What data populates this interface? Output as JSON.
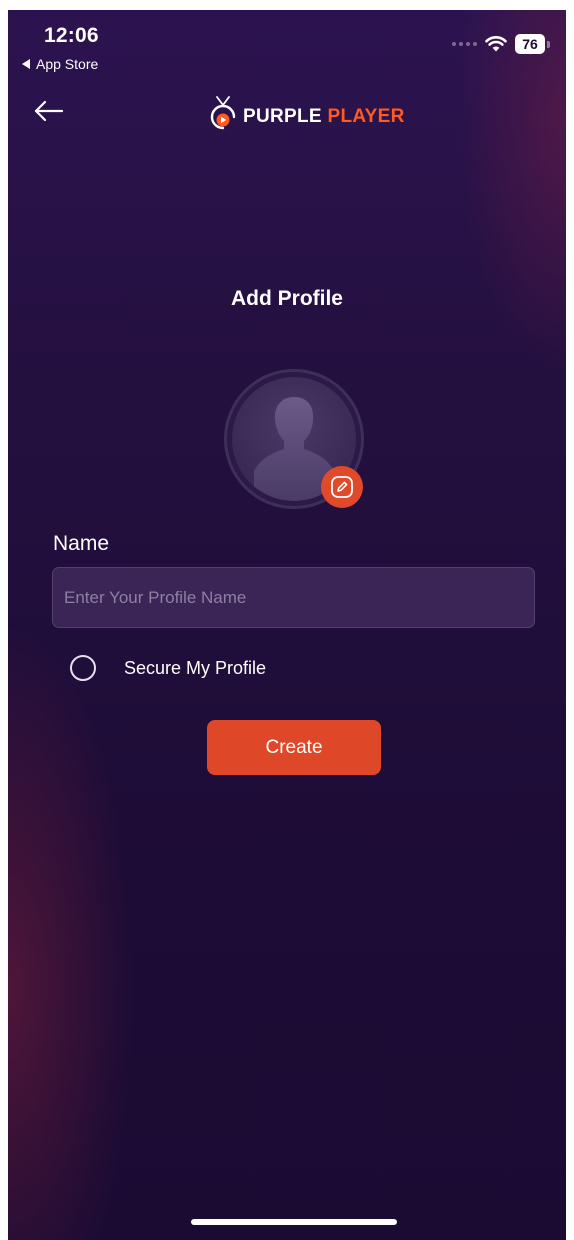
{
  "status_bar": {
    "time": "12:06",
    "back_app": "App Store",
    "battery": "76",
    "wifi_icon": "wifi-icon",
    "signal_icon": "cellular-signal-icon"
  },
  "header": {
    "back_icon": "back-arrow-icon",
    "logo_word1": "PURPLE",
    "logo_word2": "PLAYER"
  },
  "page": {
    "title": "Add Profile"
  },
  "avatar": {
    "icon": "person-silhouette-icon",
    "edit_icon": "pencil-edit-icon"
  },
  "form": {
    "name_label": "Name",
    "name_placeholder": "Enter Your Profile Name",
    "name_value": "",
    "secure_label": "Secure My Profile",
    "secure_checked": false,
    "create_label": "Create"
  },
  "colors": {
    "background": "#1d0c36",
    "accent": "#de4727",
    "logo_accent": "#ff5a1f",
    "input_bg": "#3a2556"
  }
}
